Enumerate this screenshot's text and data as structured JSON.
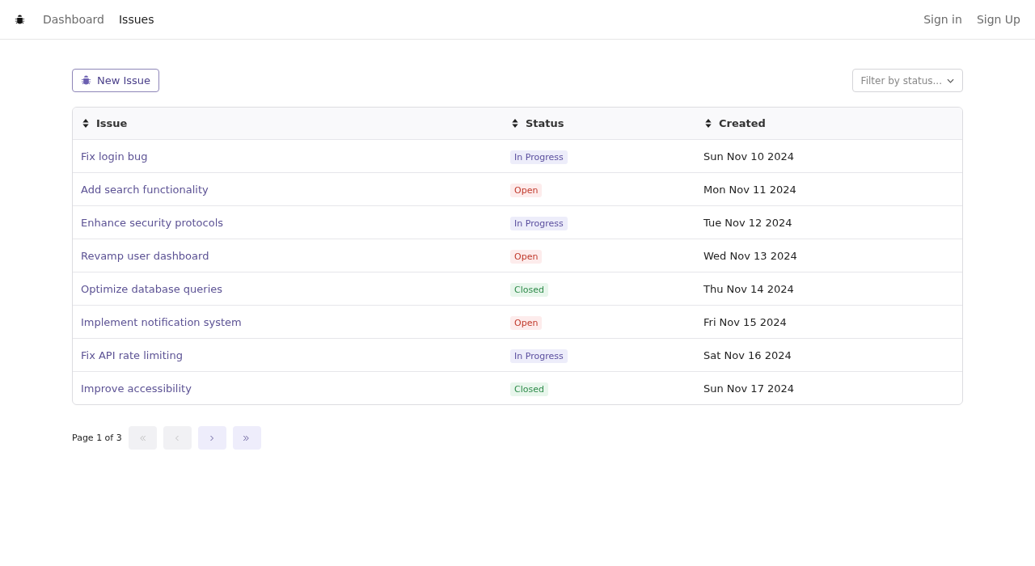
{
  "nav": {
    "links": [
      {
        "label": "Dashboard",
        "selected": false
      },
      {
        "label": "Issues",
        "selected": true
      }
    ],
    "auth": [
      "Sign in",
      "Sign Up"
    ]
  },
  "toolbar": {
    "new_button": "New Issue",
    "filter": {
      "placeholder": "Filter by status..."
    }
  },
  "table": {
    "columns": [
      "Issue",
      "Status",
      "Created"
    ],
    "rows": [
      {
        "issue": "Fix login bug",
        "status": {
          "label": "In Progress",
          "kind": "in_progress"
        },
        "created": "Sun Nov 10 2024"
      },
      {
        "issue": "Add search functionality",
        "status": {
          "label": "Open",
          "kind": "open"
        },
        "created": "Mon Nov 11 2024"
      },
      {
        "issue": "Enhance security protocols",
        "status": {
          "label": "In Progress",
          "kind": "in_progress"
        },
        "created": "Tue Nov 12 2024"
      },
      {
        "issue": "Revamp user dashboard",
        "status": {
          "label": "Open",
          "kind": "open"
        },
        "created": "Wed Nov 13 2024"
      },
      {
        "issue": "Optimize database queries",
        "status": {
          "label": "Closed",
          "kind": "closed"
        },
        "created": "Thu Nov 14 2024"
      },
      {
        "issue": "Implement notification system",
        "status": {
          "label": "Open",
          "kind": "open"
        },
        "created": "Fri Nov 15 2024"
      },
      {
        "issue": "Fix API rate limiting",
        "status": {
          "label": "In Progress",
          "kind": "in_progress"
        },
        "created": "Sat Nov 16 2024"
      },
      {
        "issue": "Improve accessibility",
        "status": {
          "label": "Closed",
          "kind": "closed"
        },
        "created": "Sun Nov 17 2024"
      }
    ]
  },
  "pagination": {
    "label": "Page 1 of 3",
    "buttons": [
      {
        "kind": "first",
        "disabled": true
      },
      {
        "kind": "prev",
        "disabled": true
      },
      {
        "kind": "next",
        "disabled": false
      },
      {
        "kind": "last",
        "disabled": false
      }
    ]
  }
}
